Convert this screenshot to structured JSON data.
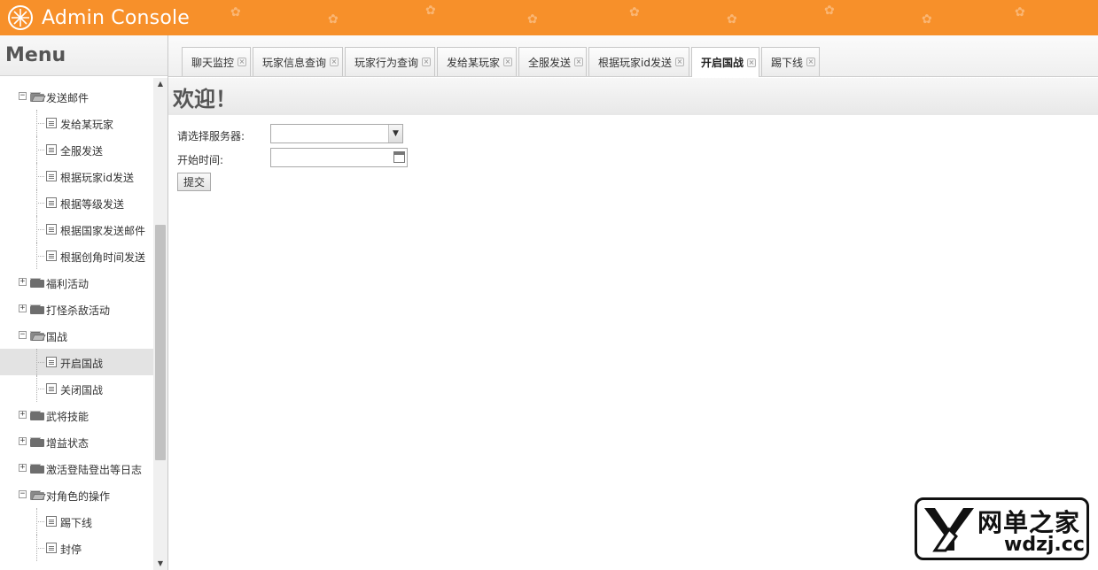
{
  "header": {
    "title": "Admin Console",
    "accent": "#f7902a"
  },
  "sidebar": {
    "title": "Menu",
    "tree": [
      {
        "label": "发送邮件",
        "type": "folder",
        "expanded": true,
        "level": 0
      },
      {
        "label": "发给某玩家",
        "type": "leaf",
        "level": 1
      },
      {
        "label": "全服发送",
        "type": "leaf",
        "level": 1
      },
      {
        "label": "根据玩家id发送",
        "type": "leaf",
        "level": 1
      },
      {
        "label": "根据等级发送",
        "type": "leaf",
        "level": 1
      },
      {
        "label": "根据国家发送邮件",
        "type": "leaf",
        "level": 1
      },
      {
        "label": "根据创角时间发送",
        "type": "leaf",
        "level": 1
      },
      {
        "label": "福利活动",
        "type": "folder",
        "expanded": false,
        "level": 0
      },
      {
        "label": "打怪杀敌活动",
        "type": "folder",
        "expanded": false,
        "level": 0
      },
      {
        "label": "国战",
        "type": "folder",
        "expanded": true,
        "level": 0
      },
      {
        "label": "开启国战",
        "type": "leaf",
        "level": 1,
        "selected": true
      },
      {
        "label": "关闭国战",
        "type": "leaf",
        "level": 1
      },
      {
        "label": "武将技能",
        "type": "folder",
        "expanded": false,
        "level": 0
      },
      {
        "label": "增益状态",
        "type": "folder",
        "expanded": false,
        "level": 0
      },
      {
        "label": "激活登陆登出等日志",
        "type": "folder",
        "expanded": false,
        "level": 0
      },
      {
        "label": "对角色的操作",
        "type": "folder",
        "expanded": true,
        "level": 0
      },
      {
        "label": "踢下线",
        "type": "leaf",
        "level": 1
      },
      {
        "label": "封停",
        "type": "leaf",
        "level": 1
      }
    ]
  },
  "tabs": [
    {
      "label": "聊天监控"
    },
    {
      "label": "玩家信息查询"
    },
    {
      "label": "玩家行为查询"
    },
    {
      "label": "发给某玩家"
    },
    {
      "label": "全服发送"
    },
    {
      "label": "根据玩家id发送"
    },
    {
      "label": "开启国战",
      "active": true
    },
    {
      "label": "踢下线"
    }
  ],
  "main": {
    "welcome": "欢迎！",
    "server_label": "请选择服务器:",
    "server_value": "",
    "start_time_label": "开始时间:",
    "start_time_value": "",
    "submit_label": "提交"
  },
  "watermark": {
    "cn": "网单之家",
    "en": "wdzj.cc"
  }
}
